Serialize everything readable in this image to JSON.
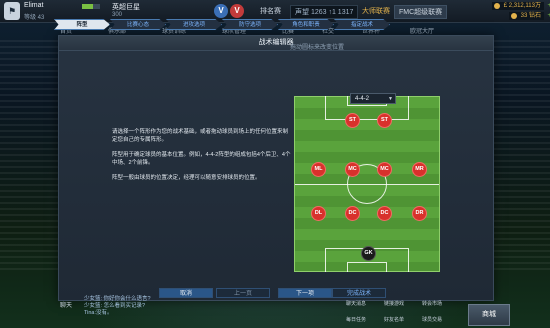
{
  "topbar": {
    "user_name": "Elimat",
    "user_sub": "等级 43",
    "club_name": "英超巨星",
    "club_sub": "300",
    "v_a": "V",
    "v_b": "V",
    "rank_label": "排名赛",
    "rank_value": "声望 1263 ↑1 1317",
    "master_label": "大师联赛",
    "master_value": "FMC超级联赛",
    "currency_1": "£ 2,312,113万",
    "currency_2": "33 钻石",
    "plus": "+"
  },
  "nav": {
    "items": [
      "首页",
      "俱乐部",
      "球员训练",
      "球队管理",
      "比赛",
      "社交",
      "世界杯",
      "欧冠大厅"
    ]
  },
  "modal": {
    "title": "战术编辑器",
    "steps": [
      "阵型",
      "比赛心态",
      "进攻选项",
      "防守选项",
      "角色和职责",
      "指定战术"
    ],
    "active_step": 0,
    "hint": "拖动圆标来改变位置",
    "description": [
      "请选择一个阵形作为您的战术基础，或者拖动球员到场上的任何位置来制定您自己的专属阵形。",
      "阵型用于确定球员的基本位置。例如，4-4-2阵型的组成包括4个后卫、4个中场、2个前锋。",
      "阵型一般由球员的位置决定，经理可以随意安排球员的位置。"
    ],
    "formation": "4-4-2",
    "caret": "▼",
    "players": [
      "ST",
      "ST",
      "ML",
      "MC",
      "MC",
      "MR",
      "DL",
      "DC",
      "DC",
      "DR",
      "GK"
    ],
    "buttons": {
      "cancel": "取消",
      "prev": "上一页",
      "next": "下一项",
      "finish": "完成战术"
    }
  },
  "chat": {
    "lines": [
      "少女篮: 你好你会什么语言?",
      "少女篮: 怎么看到买记录?",
      "Tina:没有。"
    ]
  },
  "side_tab": "聊天",
  "bottom_menu": {
    "items": [
      "聊天消息",
      "链接游戏",
      "转会市场",
      "每日任务",
      "好友名单",
      "球员交易"
    ],
    "shop": "商城"
  }
}
